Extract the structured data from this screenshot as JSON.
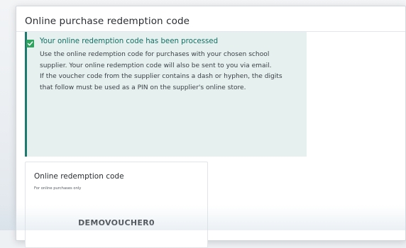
{
  "page": {
    "title": "Online purchase redemption code"
  },
  "alert": {
    "icon": "checkbox-checked-icon",
    "heading": "Your online redemption code has been processed",
    "paragraph1": "Use the online redemption code for purchases with your chosen school supplier. Your online redemption code will also be sent to you via email.",
    "paragraph2": "If the voucher code from the supplier contains a dash or hyphen, the digits that follow must be used as a PIN on the supplier's online store.",
    "accent_color": "#1d7a6f",
    "background_color": "#e6f1ef"
  },
  "card": {
    "title": "Online redemption code",
    "subtitle": "For online purchases only",
    "code": "DEMOVOUCHER0"
  }
}
